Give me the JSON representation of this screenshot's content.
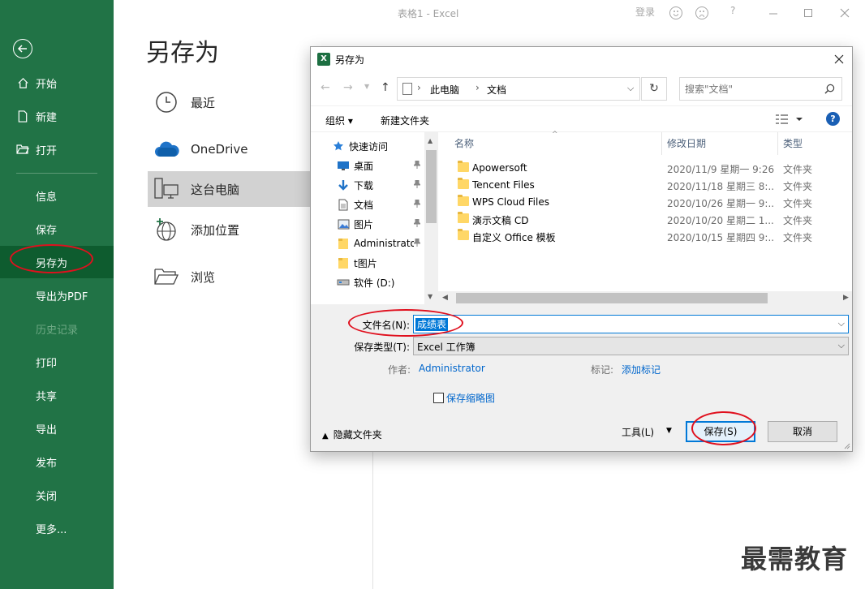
{
  "app": {
    "window_title": "表格1  -  Excel",
    "login": "登录",
    "help": "?"
  },
  "nav": {
    "items": [
      {
        "label": "开始",
        "icon": "home-icon"
      },
      {
        "label": "新建",
        "icon": "new-file-icon"
      },
      {
        "label": "打开",
        "icon": "open-folder-icon"
      },
      {
        "label": "信息"
      },
      {
        "label": "保存"
      },
      {
        "label": "另存为",
        "active": true
      },
      {
        "label": "导出为PDF"
      },
      {
        "label": "历史记录",
        "disabled": true
      },
      {
        "label": "打印"
      },
      {
        "label": "共享"
      },
      {
        "label": "导出"
      },
      {
        "label": "发布"
      },
      {
        "label": "关闭"
      },
      {
        "label": "更多..."
      }
    ]
  },
  "page": {
    "title": "另存为",
    "locations": [
      {
        "label": "最近",
        "icon": "clock-icon"
      },
      {
        "label": "OneDrive",
        "icon": "cloud-icon"
      },
      {
        "label": "这台电脑",
        "icon": "computer-icon",
        "active": true
      },
      {
        "label": "添加位置",
        "icon": "add-location-icon"
      },
      {
        "label": "浏览",
        "icon": "folder-open-icon"
      }
    ]
  },
  "dialog": {
    "title": "另存为",
    "breadcrumb": [
      "此电脑",
      "文档"
    ],
    "search_placeholder": "搜索\"文档\"",
    "toolbar": {
      "organize": "组织 ▾",
      "new_folder": "新建文件夹"
    },
    "nav_tree": [
      {
        "label": "快速访问",
        "icon": "star-icon",
        "pinned": false
      },
      {
        "label": "桌面",
        "icon": "desktop-icon",
        "pinned": true
      },
      {
        "label": "下载",
        "icon": "download-icon",
        "pinned": true
      },
      {
        "label": "文档",
        "icon": "document-icon",
        "pinned": true
      },
      {
        "label": "图片",
        "icon": "picture-icon",
        "pinned": true
      },
      {
        "label": "Administrator",
        "icon": "folder-icon",
        "pinned": true
      },
      {
        "label": "t图片",
        "icon": "folder-icon",
        "pinned": false
      },
      {
        "label": "软件 (D:)",
        "icon": "drive-icon",
        "pinned": false
      }
    ],
    "columns": [
      "名称",
      "修改日期",
      "类型"
    ],
    "files": [
      {
        "name": "Apowersoft",
        "date": "2020/11/9 星期一 9:26",
        "type": "文件夹"
      },
      {
        "name": "Tencent Files",
        "date": "2020/11/18 星期三 8:...",
        "type": "文件夹"
      },
      {
        "name": "WPS Cloud Files",
        "date": "2020/10/26 星期一 9:...",
        "type": "文件夹"
      },
      {
        "name": "演示文稿 CD",
        "date": "2020/10/20 星期二 1...",
        "type": "文件夹"
      },
      {
        "name": "自定义 Office 模板",
        "date": "2020/10/15 星期四 9:...",
        "type": "文件夹"
      }
    ],
    "filename_label": "文件名(N):",
    "filename_value": "成绩表",
    "filetype_label": "保存类型(T):",
    "filetype_value": "Excel 工作簿",
    "author_label": "作者:",
    "author_value": "Administrator",
    "tags_label": "标记:",
    "tags_value": "添加标记",
    "thumbnail_label": "保存缩略图",
    "hide_folders": "隐藏文件夹",
    "tools": "工具(L)",
    "save": "保存(S)",
    "cancel": "取消"
  },
  "watermark": "最需教育",
  "colors": {
    "nav_bg": "#217346",
    "nav_active": "#0e5c2f",
    "accent": "#0078d7",
    "annotation": "#e0101e"
  }
}
